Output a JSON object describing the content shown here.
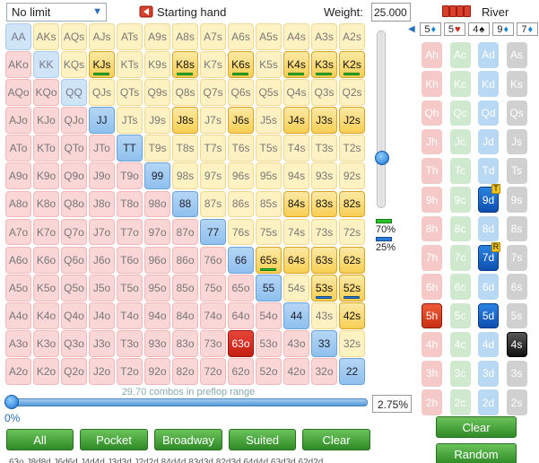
{
  "toolbar": {
    "limit_value": "No limit",
    "starting_hand_label": "Starting hand",
    "weight_label": "Weight:",
    "weight_value": "25.000"
  },
  "grid": {
    "rows": [
      [
        [
          "AA",
          "p",
          0,
          ""
        ],
        [
          "AKs",
          "s",
          0,
          ""
        ],
        [
          "AQs",
          "s",
          0,
          ""
        ],
        [
          "AJs",
          "s",
          0,
          ""
        ],
        [
          "ATs",
          "s",
          0,
          ""
        ],
        [
          "A9s",
          "s",
          0,
          ""
        ],
        [
          "A8s",
          "s",
          0,
          ""
        ],
        [
          "A7s",
          "s",
          0,
          ""
        ],
        [
          "A6s",
          "s",
          0,
          ""
        ],
        [
          "A5s",
          "s",
          0,
          ""
        ],
        [
          "A4s",
          "s",
          0,
          ""
        ],
        [
          "A3s",
          "s",
          0,
          ""
        ],
        [
          "A2s",
          "s",
          0,
          ""
        ]
      ],
      [
        [
          "AKo",
          "o",
          0,
          ""
        ],
        [
          "KK",
          "p",
          0,
          ""
        ],
        [
          "KQs",
          "s",
          0,
          ""
        ],
        [
          "KJs",
          "s",
          1,
          "g"
        ],
        [
          "KTs",
          "s",
          0,
          ""
        ],
        [
          "K9s",
          "s",
          0,
          ""
        ],
        [
          "K8s",
          "s",
          1,
          "g"
        ],
        [
          "K7s",
          "s",
          0,
          ""
        ],
        [
          "K6s",
          "s",
          1,
          "g"
        ],
        [
          "K5s",
          "s",
          0,
          ""
        ],
        [
          "K4s",
          "s",
          1,
          "g"
        ],
        [
          "K3s",
          "s",
          1,
          "g"
        ],
        [
          "K2s",
          "s",
          1,
          "g"
        ]
      ],
      [
        [
          "AQo",
          "o",
          0,
          ""
        ],
        [
          "KQo",
          "o",
          0,
          ""
        ],
        [
          "QQ",
          "p",
          0,
          ""
        ],
        [
          "QJs",
          "s",
          0,
          ""
        ],
        [
          "QTs",
          "s",
          0,
          ""
        ],
        [
          "Q9s",
          "s",
          0,
          ""
        ],
        [
          "Q8s",
          "s",
          0,
          ""
        ],
        [
          "Q7s",
          "s",
          0,
          ""
        ],
        [
          "Q6s",
          "s",
          0,
          ""
        ],
        [
          "Q5s",
          "s",
          0,
          ""
        ],
        [
          "Q4s",
          "s",
          0,
          ""
        ],
        [
          "Q3s",
          "s",
          0,
          ""
        ],
        [
          "Q2s",
          "s",
          0,
          ""
        ]
      ],
      [
        [
          "AJo",
          "o",
          0,
          ""
        ],
        [
          "KJo",
          "o",
          0,
          ""
        ],
        [
          "QJo",
          "o",
          0,
          ""
        ],
        [
          "JJ",
          "p",
          1,
          ""
        ],
        [
          "JTs",
          "s",
          0,
          ""
        ],
        [
          "J9s",
          "s",
          0,
          ""
        ],
        [
          "J8s",
          "s",
          1,
          ""
        ],
        [
          "J7s",
          "s",
          0,
          ""
        ],
        [
          "J6s",
          "s",
          1,
          ""
        ],
        [
          "J5s",
          "s",
          0,
          ""
        ],
        [
          "J4s",
          "s",
          1,
          ""
        ],
        [
          "J3s",
          "s",
          1,
          ""
        ],
        [
          "J2s",
          "s",
          1,
          ""
        ]
      ],
      [
        [
          "ATo",
          "o",
          0,
          ""
        ],
        [
          "KTo",
          "o",
          0,
          ""
        ],
        [
          "QTo",
          "o",
          0,
          ""
        ],
        [
          "JTo",
          "o",
          0,
          ""
        ],
        [
          "TT",
          "p",
          1,
          ""
        ],
        [
          "T9s",
          "s",
          0,
          ""
        ],
        [
          "T8s",
          "s",
          0,
          ""
        ],
        [
          "T7s",
          "s",
          0,
          ""
        ],
        [
          "T6s",
          "s",
          0,
          ""
        ],
        [
          "T5s",
          "s",
          0,
          ""
        ],
        [
          "T4s",
          "s",
          0,
          ""
        ],
        [
          "T3s",
          "s",
          0,
          ""
        ],
        [
          "T2s",
          "s",
          0,
          ""
        ]
      ],
      [
        [
          "A9o",
          "o",
          0,
          ""
        ],
        [
          "K9o",
          "o",
          0,
          ""
        ],
        [
          "Q9o",
          "o",
          0,
          ""
        ],
        [
          "J9o",
          "o",
          0,
          ""
        ],
        [
          "T9o",
          "o",
          0,
          ""
        ],
        [
          "99",
          "p",
          1,
          ""
        ],
        [
          "98s",
          "s",
          0,
          ""
        ],
        [
          "97s",
          "s",
          0,
          ""
        ],
        [
          "96s",
          "s",
          0,
          ""
        ],
        [
          "95s",
          "s",
          0,
          ""
        ],
        [
          "94s",
          "s",
          0,
          ""
        ],
        [
          "93s",
          "s",
          0,
          ""
        ],
        [
          "92s",
          "s",
          0,
          ""
        ]
      ],
      [
        [
          "A8o",
          "o",
          0,
          ""
        ],
        [
          "K8o",
          "o",
          0,
          ""
        ],
        [
          "Q8o",
          "o",
          0,
          ""
        ],
        [
          "J8o",
          "o",
          0,
          ""
        ],
        [
          "T8o",
          "o",
          0,
          ""
        ],
        [
          "98o",
          "o",
          0,
          ""
        ],
        [
          "88",
          "p",
          1,
          ""
        ],
        [
          "87s",
          "s",
          0,
          ""
        ],
        [
          "86s",
          "s",
          0,
          ""
        ],
        [
          "85s",
          "s",
          0,
          ""
        ],
        [
          "84s",
          "s",
          1,
          ""
        ],
        [
          "83s",
          "s",
          1,
          ""
        ],
        [
          "82s",
          "s",
          1,
          ""
        ]
      ],
      [
        [
          "A7o",
          "o",
          0,
          ""
        ],
        [
          "K7o",
          "o",
          0,
          ""
        ],
        [
          "Q7o",
          "o",
          0,
          ""
        ],
        [
          "J7o",
          "o",
          0,
          ""
        ],
        [
          "T7o",
          "o",
          0,
          ""
        ],
        [
          "97o",
          "o",
          0,
          ""
        ],
        [
          "87o",
          "o",
          0,
          ""
        ],
        [
          "77",
          "p",
          1,
          ""
        ],
        [
          "76s",
          "s",
          0,
          ""
        ],
        [
          "75s",
          "s",
          0,
          ""
        ],
        [
          "74s",
          "s",
          0,
          ""
        ],
        [
          "73s",
          "s",
          0,
          ""
        ],
        [
          "72s",
          "s",
          0,
          ""
        ]
      ],
      [
        [
          "A6o",
          "o",
          0,
          ""
        ],
        [
          "K6o",
          "o",
          0,
          ""
        ],
        [
          "Q6o",
          "o",
          0,
          ""
        ],
        [
          "J6o",
          "o",
          0,
          ""
        ],
        [
          "T6o",
          "o",
          0,
          ""
        ],
        [
          "96o",
          "o",
          0,
          ""
        ],
        [
          "86o",
          "o",
          0,
          ""
        ],
        [
          "76o",
          "o",
          0,
          ""
        ],
        [
          "66",
          "p",
          1,
          ""
        ],
        [
          "65s",
          "s",
          1,
          "g"
        ],
        [
          "64s",
          "s",
          1,
          ""
        ],
        [
          "63s",
          "s",
          1,
          ""
        ],
        [
          "62s",
          "s",
          1,
          ""
        ]
      ],
      [
        [
          "A5o",
          "o",
          0,
          ""
        ],
        [
          "K5o",
          "o",
          0,
          ""
        ],
        [
          "Q5o",
          "o",
          0,
          ""
        ],
        [
          "J5o",
          "o",
          0,
          ""
        ],
        [
          "T5o",
          "o",
          0,
          ""
        ],
        [
          "95o",
          "o",
          0,
          ""
        ],
        [
          "85o",
          "o",
          0,
          ""
        ],
        [
          "75o",
          "o",
          0,
          ""
        ],
        [
          "65o",
          "o",
          0,
          ""
        ],
        [
          "55",
          "p",
          1,
          ""
        ],
        [
          "54s",
          "s",
          0,
          ""
        ],
        [
          "53s",
          "s",
          1,
          "b"
        ],
        [
          "52s",
          "s",
          1,
          "b"
        ]
      ],
      [
        [
          "A4o",
          "o",
          0,
          ""
        ],
        [
          "K4o",
          "o",
          0,
          ""
        ],
        [
          "Q4o",
          "o",
          0,
          ""
        ],
        [
          "J4o",
          "o",
          0,
          ""
        ],
        [
          "T4o",
          "o",
          0,
          ""
        ],
        [
          "94o",
          "o",
          0,
          ""
        ],
        [
          "84o",
          "o",
          0,
          ""
        ],
        [
          "74o",
          "o",
          0,
          ""
        ],
        [
          "64o",
          "o",
          0,
          ""
        ],
        [
          "54o",
          "o",
          0,
          ""
        ],
        [
          "44",
          "p",
          1,
          ""
        ],
        [
          "43s",
          "s",
          0,
          ""
        ],
        [
          "42s",
          "s",
          1,
          ""
        ]
      ],
      [
        [
          "A3o",
          "o",
          0,
          ""
        ],
        [
          "K3o",
          "o",
          0,
          ""
        ],
        [
          "Q3o",
          "o",
          0,
          ""
        ],
        [
          "J3o",
          "o",
          0,
          ""
        ],
        [
          "T3o",
          "o",
          0,
          ""
        ],
        [
          "93o",
          "o",
          0,
          ""
        ],
        [
          "83o",
          "o",
          0,
          ""
        ],
        [
          "73o",
          "o",
          0,
          ""
        ],
        [
          "63o",
          "o",
          1,
          ""
        ],
        [
          "53o",
          "o",
          0,
          ""
        ],
        [
          "43o",
          "o",
          0,
          ""
        ],
        [
          "33",
          "p",
          1,
          ""
        ],
        [
          "32s",
          "s",
          0,
          ""
        ]
      ],
      [
        [
          "A2o",
          "o",
          0,
          ""
        ],
        [
          "K2o",
          "o",
          0,
          ""
        ],
        [
          "Q2o",
          "o",
          0,
          ""
        ],
        [
          "J2o",
          "o",
          0,
          ""
        ],
        [
          "T2o",
          "o",
          0,
          ""
        ],
        [
          "92o",
          "o",
          0,
          ""
        ],
        [
          "82o",
          "o",
          0,
          ""
        ],
        [
          "72o",
          "o",
          0,
          ""
        ],
        [
          "62o",
          "o",
          0,
          ""
        ],
        [
          "52o",
          "o",
          0,
          ""
        ],
        [
          "42o",
          "o",
          0,
          ""
        ],
        [
          "32o",
          "o",
          0,
          ""
        ],
        [
          "22",
          "p",
          1,
          ""
        ]
      ]
    ]
  },
  "weight_slider": {
    "level_fraction": 0.72,
    "pct_green": "70%",
    "pct_blue": "25%"
  },
  "range": {
    "combos_text": "29.70 combos in preflop range",
    "zero_label": "0%",
    "percent_value": "2.75%",
    "slider_fraction": 0.0
  },
  "buttons": {
    "all": "All",
    "pocket": "Pocket",
    "broadway": "Broadway",
    "suited": "Suited",
    "clear": "Clear"
  },
  "hands_text": "63o,J8d8d,J6d6d,J4d4d,J3d3d,J2d2d,84d4d,83d3d,82d3d,64d4d,63d3d,62d2d",
  "board": {
    "title": "River",
    "cards": [
      {
        "rank": "5",
        "suit": "♦",
        "cls": "suit-d"
      },
      {
        "rank": "5",
        "suit": "♥",
        "cls": "suit-h"
      },
      {
        "rank": "4",
        "suit": "♠",
        "cls": "suit-s"
      },
      {
        "rank": "9",
        "suit": "♦",
        "cls": "suit-d"
      },
      {
        "rank": "7",
        "suit": "♦",
        "cls": "suit-d"
      }
    ]
  },
  "card_grid": {
    "ranks": [
      "A",
      "K",
      "Q",
      "J",
      "T",
      "9",
      "8",
      "7",
      "6",
      "5",
      "4",
      "3",
      "2"
    ],
    "suits": [
      "h",
      "c",
      "d",
      "s"
    ],
    "selected": [
      "9d",
      "7d",
      "5h",
      "5d",
      "4s"
    ],
    "tags": {
      "9d": "T",
      "7d": "R"
    }
  },
  "side_buttons": {
    "clear": "Clear",
    "random": "Random"
  }
}
